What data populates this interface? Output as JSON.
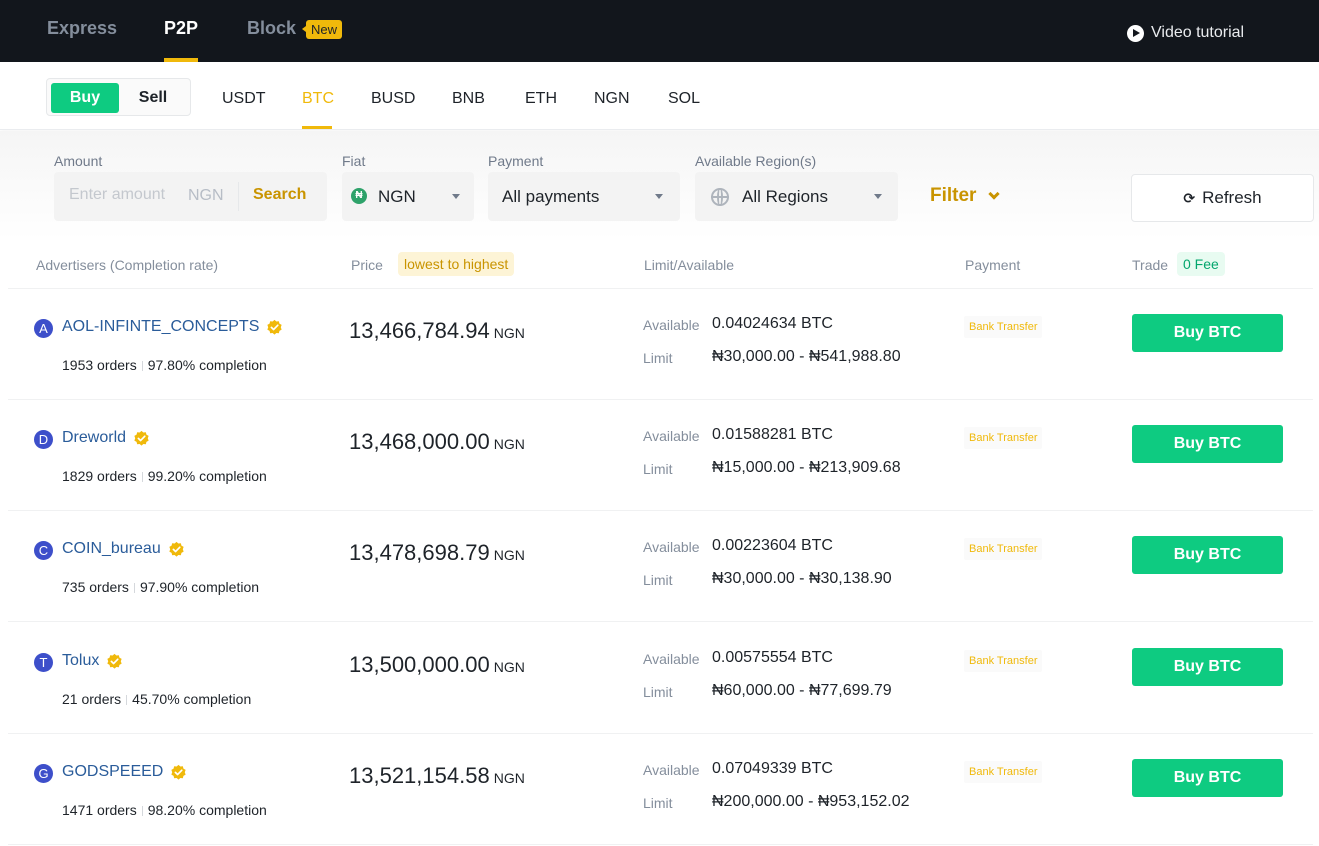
{
  "topnav": {
    "tabs": [
      {
        "label": "Express",
        "active": false
      },
      {
        "label": "P2P",
        "active": true
      },
      {
        "label": "Block",
        "active": false,
        "badge": "New"
      }
    ],
    "video_tutorial": "Video tutorial"
  },
  "trade_side": {
    "buy_label": "Buy",
    "sell_label": "Sell",
    "selected": "Buy"
  },
  "assets": {
    "items": [
      "USDT",
      "BTC",
      "BUSD",
      "BNB",
      "ETH",
      "NGN",
      "SOL"
    ],
    "selected": "BTC"
  },
  "filters": {
    "amount": {
      "label": "Amount",
      "placeholder": "Enter amount",
      "value": "",
      "currency": "NGN",
      "search_label": "Search"
    },
    "fiat": {
      "label": "Fiat",
      "value": "NGN",
      "icon": "naira-icon",
      "icon_glyph": "₦"
    },
    "payment": {
      "label": "Payment",
      "value": "All payments"
    },
    "region": {
      "label": "Available Region(s)",
      "value": "All Regions",
      "icon": "globe-icon"
    },
    "filter_label": "Filter",
    "refresh_label": "Refresh",
    "refresh_glyph": "⟳"
  },
  "table": {
    "headers": {
      "advertisers": "Advertisers (Completion rate)",
      "price": "Price",
      "price_sort": "lowest to highest",
      "limit": "Limit/Available",
      "payment": "Payment",
      "trade": "Trade",
      "trade_fee": "0 Fee"
    },
    "available_label": "Available",
    "limit_label": "Limit",
    "rows": [
      {
        "initial": "A",
        "name": "AOL-INFINTE_CONCEPTS",
        "verified": true,
        "orders": "1953 orders",
        "completion": "97.80% completion",
        "price": "13,466,784.94",
        "price_currency": "NGN",
        "available": "0.04024634 BTC",
        "limit": "₦30,000.00 - ₦541,988.80",
        "payment": "Bank Transfer",
        "action": "Buy BTC"
      },
      {
        "initial": "D",
        "name": "Dreworld",
        "verified": true,
        "orders": "1829 orders",
        "completion": "99.20% completion",
        "price": "13,468,000.00",
        "price_currency": "NGN",
        "available": "0.01588281 BTC",
        "limit": "₦15,000.00 - ₦213,909.68",
        "payment": "Bank Transfer",
        "action": "Buy BTC"
      },
      {
        "initial": "C",
        "name": "COIN_bureau",
        "verified": true,
        "orders": "735 orders",
        "completion": "97.90% completion",
        "price": "13,478,698.79",
        "price_currency": "NGN",
        "available": "0.00223604 BTC",
        "limit": "₦30,000.00 - ₦30,138.90",
        "payment": "Bank Transfer",
        "action": "Buy BTC"
      },
      {
        "initial": "T",
        "name": "Tolux",
        "verified": true,
        "orders": "21 orders",
        "completion": "45.70% completion",
        "price": "13,500,000.00",
        "price_currency": "NGN",
        "available": "0.00575554 BTC",
        "limit": "₦60,000.00 - ₦77,699.79",
        "payment": "Bank Transfer",
        "action": "Buy BTC"
      },
      {
        "initial": "G",
        "name": "GODSPEEED",
        "verified": true,
        "orders": "1471 orders",
        "completion": "98.20% completion",
        "price": "13,521,154.58",
        "price_currency": "NGN",
        "available": "0.07049339 BTC",
        "limit": "₦200,000.00 - ₦953,152.02",
        "payment": "Bank Transfer",
        "action": "Buy BTC"
      }
    ]
  },
  "colors": {
    "brand_yellow": "#f0b90b",
    "buy_green": "#0ecb81",
    "nav_bg": "#12161c",
    "link_blue": "#2a5c9a",
    "avatar_bg": "#3d4fca"
  }
}
